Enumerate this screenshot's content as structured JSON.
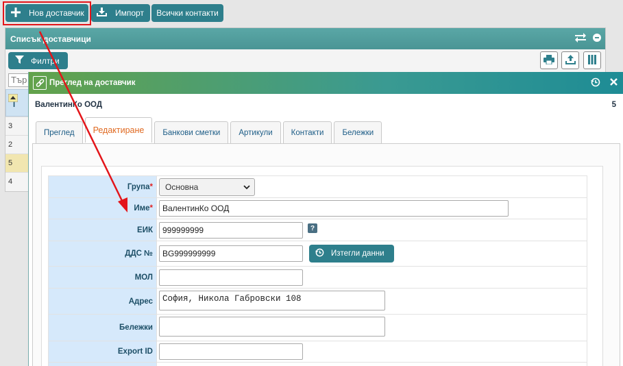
{
  "toolbar": {
    "new_supplier": "Нов доставчик",
    "import": "Импорт",
    "all_contacts": "Всички контакти"
  },
  "list_panel": {
    "title": "Списък доставчици",
    "filter_label": "Филтри",
    "search_value": "Тър",
    "sort_header_text": "I",
    "rows": [
      "3",
      "2",
      "5",
      "4"
    ],
    "selected_row": "5"
  },
  "dialog": {
    "title": "Преглед на доставчик",
    "supplier_name": "ВалентинКо ООД",
    "record_id": "5",
    "tabs": [
      {
        "label": "Преглед"
      },
      {
        "label": "Редактиране"
      },
      {
        "label": "Банкови сметки"
      },
      {
        "label": "Артикули"
      },
      {
        "label": "Контакти"
      },
      {
        "label": "Бележки"
      }
    ],
    "active_tab": "Редактиране",
    "form": {
      "group_label": "Група",
      "group_value": "Основна",
      "name_label": "Име",
      "name_value": "ВалентинКо ООД",
      "eik_label": "ЕИК",
      "eik_value": "999999999",
      "help_glyph": "?",
      "vat_label": "ДДС №",
      "vat_value": "BG999999999",
      "fetch_button": "Изтегли данни",
      "mol_label": "МОЛ",
      "mol_value": "",
      "address_label": "Адрес",
      "address_value": "София, Никола Габровски 108",
      "notes_label": "Бележки",
      "notes_value": "",
      "export_label": "Export ID",
      "export_value": "",
      "required_mark": "*"
    }
  },
  "colors": {
    "primary_button": "#2e7f8c",
    "highlight_box": "#e3151a",
    "annotation_arrow": "#e3151a",
    "active_tab_text": "#e06a22",
    "label_cell_bg": "#d6e9fb",
    "selected_row_bg": "#f1e6b0"
  },
  "icons": {
    "new": "plus-icon",
    "import": "download-tray-icon",
    "filter": "funnel-icon",
    "print": "printer-icon",
    "export": "upload-tray-icon",
    "columns": "columns-icon",
    "dialog": "link-icon",
    "reload": "history-icon",
    "close": "close-icon"
  }
}
